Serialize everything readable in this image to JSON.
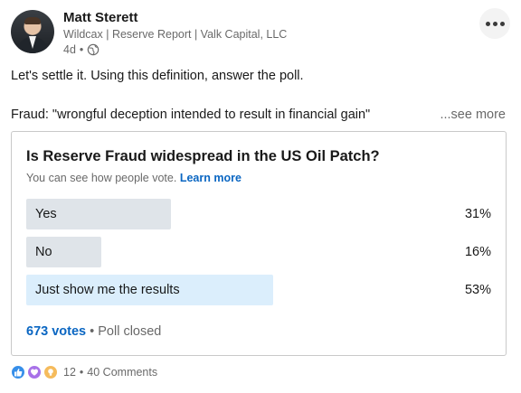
{
  "author": {
    "name": "Matt Sterett",
    "headline": "Wildcax | Reserve Report | Valk Capital, LLC",
    "time": "4d",
    "visibility_separator": "•",
    "visibility_icon": "globe-icon"
  },
  "post": {
    "line1": "Let's settle it. Using this definition, answer the poll.",
    "line2": "Fraud: \"wrongful deception intended to result in financial gain\"",
    "see_more": "...see more"
  },
  "poll": {
    "question": "Is Reserve Fraud widespread in the US Oil Patch?",
    "note": "You can see how people vote.",
    "learn_more": "Learn more",
    "options": [
      {
        "label": "Yes",
        "percent_text": "31%",
        "percent": 31,
        "selected": false
      },
      {
        "label": "No",
        "percent_text": "16%",
        "percent": 16,
        "selected": false
      },
      {
        "label": "Just show me the results",
        "percent_text": "53%",
        "percent": 53,
        "selected": true
      }
    ],
    "votes": "673 votes",
    "separator": "•",
    "status": "Poll closed"
  },
  "social": {
    "reactions": [
      "like-icon",
      "support-icon",
      "insightful-icon"
    ],
    "reactions_count": "12",
    "separator": "•",
    "comments": "40 Comments"
  },
  "colors": {
    "link": "#0a66c2",
    "bar": "#dfe4e9",
    "bar_selected": "#dbeefc"
  }
}
